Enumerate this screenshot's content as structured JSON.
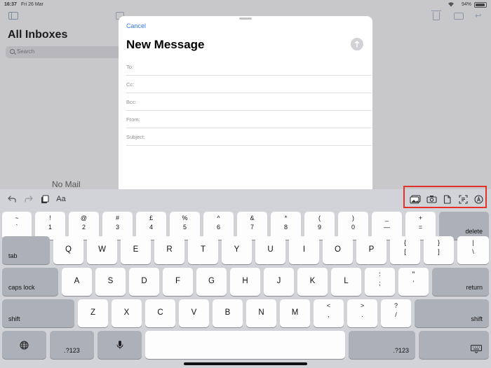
{
  "status_bar": {
    "time": "16:37",
    "date": "Fri 26 Mar",
    "battery": "94%"
  },
  "mail": {
    "title": "All Inboxes",
    "search_placeholder": "Search",
    "empty_text": "No Mail"
  },
  "compose": {
    "cancel_label": "Cancel",
    "title": "New Message",
    "fields": [
      {
        "label": "To:",
        "value": ""
      },
      {
        "label": "Cc:",
        "value": ""
      },
      {
        "label": "Bcc:",
        "value": ""
      },
      {
        "label": "From:",
        "value": ""
      },
      {
        "label": "Subject:",
        "value": ""
      }
    ]
  },
  "shortcut_bar": {
    "format_label": "Aa",
    "right_icons": [
      "photo-library-icon",
      "camera-icon",
      "document-icon",
      "scan-document-icon",
      "markup-icon"
    ]
  },
  "keyboard": {
    "row1": [
      {
        "top": "~",
        "bot": "`"
      },
      {
        "top": "!",
        "bot": "1"
      },
      {
        "top": "@",
        "bot": "2"
      },
      {
        "top": "#",
        "bot": "3"
      },
      {
        "top": "£",
        "bot": "4"
      },
      {
        "top": "%",
        "bot": "5"
      },
      {
        "top": "^",
        "bot": "6"
      },
      {
        "top": "&",
        "bot": "7"
      },
      {
        "top": "*",
        "bot": "8"
      },
      {
        "top": "(",
        "bot": "9"
      },
      {
        "top": ")",
        "bot": "0"
      },
      {
        "top": "_",
        "bot": "—"
      },
      {
        "top": "+",
        "bot": "="
      }
    ],
    "delete_label": "delete",
    "tab_label": "tab",
    "row2": [
      "Q",
      "W",
      "E",
      "R",
      "T",
      "Y",
      "U",
      "I",
      "O",
      "P"
    ],
    "row2_sym": [
      {
        "top": "{",
        "bot": "["
      },
      {
        "top": "}",
        "bot": "]"
      },
      {
        "top": "|",
        "bot": "\\"
      }
    ],
    "caps_label": "caps lock",
    "row3": [
      "A",
      "S",
      "D",
      "F",
      "G",
      "H",
      "J",
      "K",
      "L"
    ],
    "row3_sym": [
      {
        "top": ":",
        "bot": ";"
      },
      {
        "top": "”",
        "bot": "’"
      }
    ],
    "return_label": "return",
    "shift_label": "shift",
    "row4": [
      "Z",
      "X",
      "C",
      "V",
      "B",
      "N",
      "M"
    ],
    "row4_sym": [
      {
        "top": "<",
        "bot": ","
      },
      {
        "top": ">",
        "bot": "."
      },
      {
        "top": "?",
        "bot": "/"
      }
    ],
    "numbers_label": ".?123"
  },
  "colors": {
    "accent": "#3478f6",
    "highlight": "#e3322a"
  }
}
